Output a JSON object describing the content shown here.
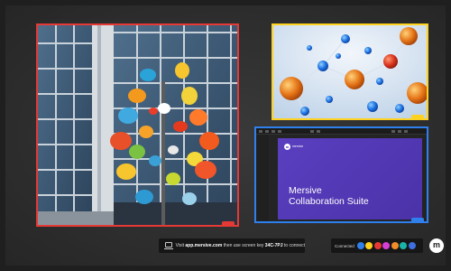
{
  "posts": [
    {
      "name": "building-sculpture-post",
      "border_color": "#e53935",
      "tag": ""
    },
    {
      "name": "molecules-post",
      "border_color": "#ffd21f",
      "tag": ""
    },
    {
      "name": "app-window-post",
      "border_color": "#2f80ed",
      "tag": ""
    }
  ],
  "slide": {
    "logo": "m",
    "brand": "mersive",
    "title_line1": "Mersive",
    "title_line2": "Collaboration Suite"
  },
  "connect": {
    "prefix": "Visit ",
    "url": "app.mersive.com",
    "middle": " then use screen key ",
    "key": "34C-7PJ",
    "suffix": " to connect"
  },
  "status": {
    "label": "Connected",
    "users": [
      {
        "initials": "",
        "color": "#2f80ed"
      },
      {
        "initials": "",
        "color": "#ffd21f"
      },
      {
        "initials": "",
        "color": "#e53935"
      },
      {
        "initials": "",
        "color": "#d63fd6"
      },
      {
        "initials": "",
        "color": "#f28c28"
      },
      {
        "initials": "",
        "color": "#18b6a8"
      },
      {
        "initials": "",
        "color": "#3d6fe0"
      }
    ]
  },
  "logo": "m"
}
